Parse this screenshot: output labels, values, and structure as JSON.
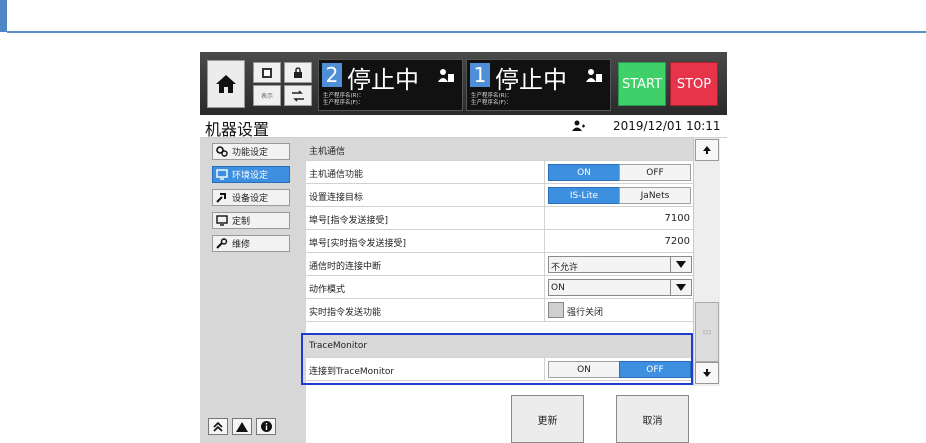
{
  "hmi": {
    "status_left": {
      "number": "2",
      "text": "停止中",
      "program_lines": [
        "生产程序名(R)：",
        "生产程序名(F)："
      ]
    },
    "status_right": {
      "number": "1",
      "text": "停止中",
      "program_lines": [
        "生产程序名(R)：",
        "生产程序名(F)："
      ]
    },
    "icon_grid_label": "表示",
    "start_label": "START",
    "stop_label": "STOP"
  },
  "header": {
    "title": "机器设置",
    "datetime": "2019/12/01 10:11"
  },
  "sidebar": {
    "items": [
      {
        "label": "功能设定",
        "icon": "gears-icon",
        "active": false
      },
      {
        "label": "环境设定",
        "icon": "monitor-icon",
        "active": true
      },
      {
        "label": "设备设定",
        "icon": "tool-icon",
        "active": false
      },
      {
        "label": "定制",
        "icon": "monitor-icon",
        "active": false
      },
      {
        "label": "维修",
        "icon": "wrench-icon",
        "active": false
      }
    ]
  },
  "settings": {
    "section_host": "主机通信",
    "host_comm": {
      "label": "主机通信功能",
      "on": "ON",
      "off": "OFF",
      "selected": "ON"
    },
    "target": {
      "label": "设置连接目标",
      "opt1": "IS-Lite",
      "opt2": "JaNets",
      "selected": "IS-Lite"
    },
    "port_cmd": {
      "label": "埠号[指令发送接受]",
      "value": "7100"
    },
    "port_rt": {
      "label": "埠号[实时指令发送接受]",
      "value": "7200"
    },
    "disconnect": {
      "label": "通信时的连接中断",
      "value": "不允许"
    },
    "mode": {
      "label": "动作模式",
      "value": "ON"
    },
    "realtime": {
      "label": "实时指令发送功能",
      "check_label": "强行关闭",
      "checked": false
    },
    "section_trace": "TraceMonitor",
    "trace_connect": {
      "label": "连接到TraceMonitor",
      "on": "ON",
      "off": "OFF",
      "selected": "OFF"
    }
  },
  "actions": {
    "update": "更新",
    "cancel": "取消"
  },
  "colors": {
    "accent": "#3d8fe0",
    "start": "#3fd06a",
    "stop": "#e8344a",
    "highlight": "#1f3bd0"
  }
}
